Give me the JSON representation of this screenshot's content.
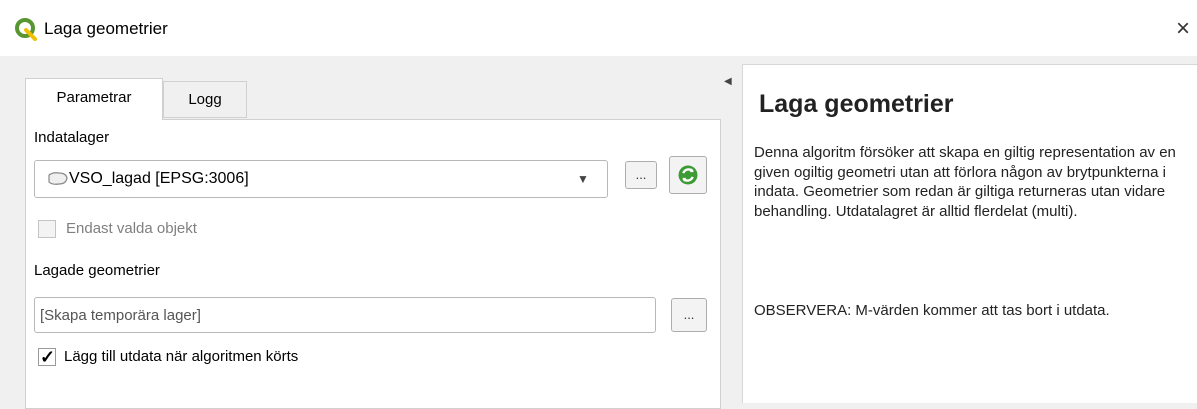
{
  "window": {
    "title": "Laga geometrier",
    "close_glyph": "×",
    "logo_icon": "qgis-logo-icon"
  },
  "tabs": [
    {
      "label": "Parametrar",
      "active": true
    },
    {
      "label": "Logg",
      "active": false
    }
  ],
  "params": {
    "input_layer_label": "Indatalager",
    "input_layer_value": "VSO_lagad [EPSG:3006]",
    "browse_label": "...",
    "selected_only_label": "Endast valda objekt",
    "selected_only_checked": false,
    "output_label": "Lagade geometrier",
    "output_placeholder": "[Skapa temporära lager]",
    "output_browse_label": "...",
    "open_output_label": "Lägg till utdata när algoritmen körts",
    "open_output_checked": true
  },
  "help": {
    "title": "Laga geometrier",
    "body": "Denna algoritm försöker att skapa en giltig representation av en given ogiltig geometri utan att förlora någon av brytpunkterna i indata. Geometrier som redan är giltiga returneras utan vidare behandling. Utdatalagret är alltid flerdelat (multi).",
    "note": "OBSERVERA: M-värden kommer att tas bort i utdata."
  },
  "colors": {
    "qgis_green": "#589632",
    "qgis_yellow": "#f0c000",
    "iterate_green": "#3d9b35"
  },
  "icons": [
    "qgis-logo-icon",
    "close-icon",
    "polygon-layer-icon",
    "chevron-down-icon",
    "iterate-icon",
    "collapse-arrow-icon",
    "checkmark-icon"
  ]
}
